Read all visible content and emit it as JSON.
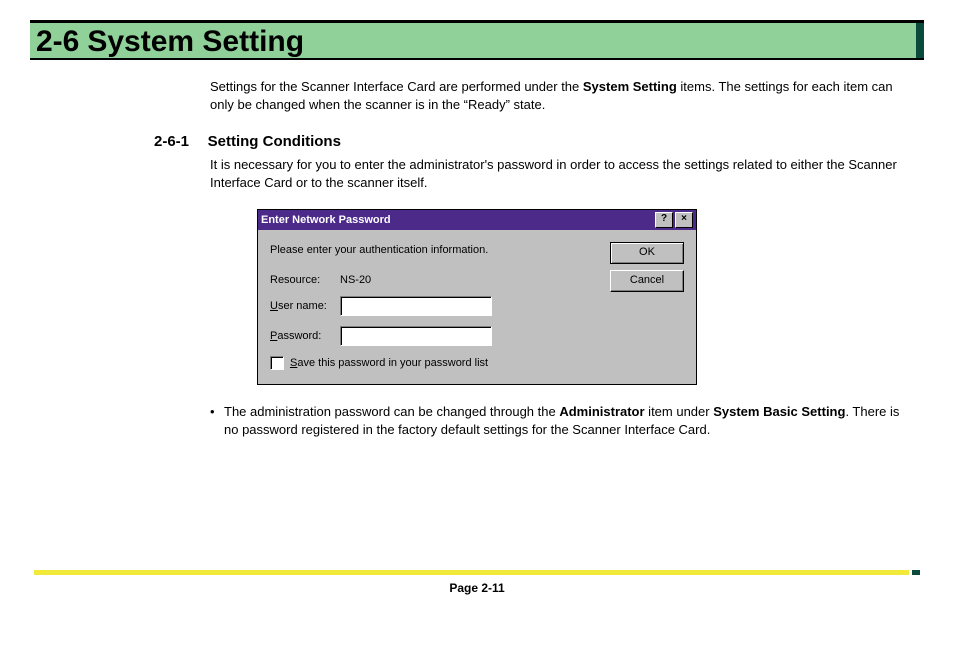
{
  "header": {
    "number": "2-6",
    "title": "System Setting"
  },
  "intro": {
    "text_a": "Settings for the Scanner Interface Card are performed under the ",
    "bold_a": "System Setting",
    "text_b": " items. The settings for each item can only be changed when the scanner is in the “Ready” state."
  },
  "subsection": {
    "number": "2-6-1",
    "title": "Setting Conditions",
    "text": "It is necessary for you to enter the administrator's password in order to access the settings related to either the Scanner Interface Card or to the scanner itself."
  },
  "dialog": {
    "title": "Enter Network Password",
    "prompt": "Please enter your authentication information.",
    "resource_label": "Resource:",
    "resource_value": "NS-20",
    "username_label_pre": "U",
    "username_label": "ser name:",
    "password_label_pre": "P",
    "password_label": "assword:",
    "save_label_pre": "S",
    "save_label": "ave this password in your password list",
    "ok": "OK",
    "cancel": "Cancel"
  },
  "bullet": {
    "mark": "•",
    "text_a": "The administration password can be changed through the ",
    "bold_a": "Administrator",
    "text_b": " item under ",
    "bold_b": "System Basic Setting",
    "text_c": ". There is no password registered in the factory default settings for the Scanner Interface Card."
  },
  "footer": {
    "page": "Page 2-11"
  }
}
